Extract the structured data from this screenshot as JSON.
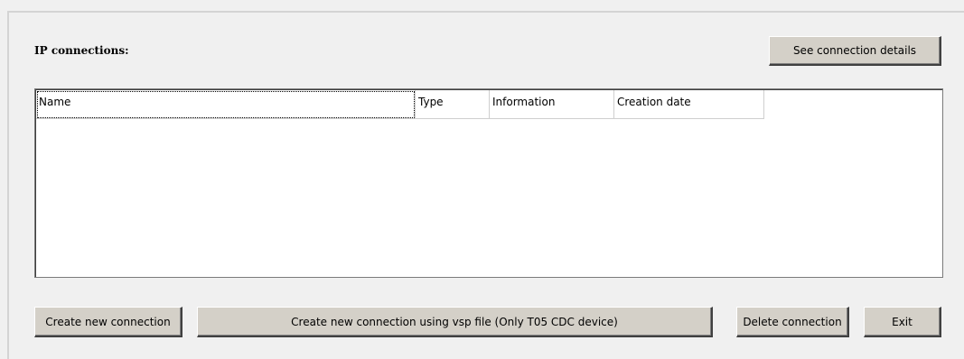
{
  "section": {
    "title": "IP connections:"
  },
  "buttons": {
    "see_details": "See connection details",
    "create_new": "Create new connection",
    "create_vsp": "Create new connection using vsp file (Only T05 CDC device)",
    "delete": "Delete connection",
    "exit": "Exit"
  },
  "table": {
    "columns": [
      "Name",
      "Type",
      "Information",
      "Creation date"
    ],
    "rows": []
  }
}
